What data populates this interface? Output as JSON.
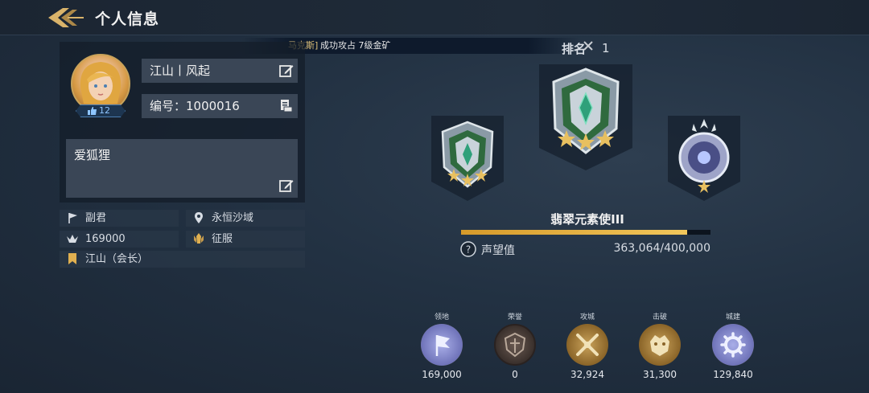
{
  "header": {
    "title": "个人信息"
  },
  "ticker": {
    "name": "马克斯]",
    "message": "成功攻占 7级金矿"
  },
  "profile": {
    "likes": "12",
    "nickname": "江山丨风起",
    "id_text": "编号：1000016",
    "signature": "爱狐狸"
  },
  "info": {
    "role": "副君",
    "region": "永恒沙域",
    "power": "169000",
    "mode": "征服",
    "guild": "江山（会长）"
  },
  "rank": {
    "label": "排名",
    "value": "1",
    "title": "翡翠元素使III",
    "reputation_label": "声望值",
    "reputation_text": "363,064/400,000",
    "progress_fraction": 0.9077
  },
  "stats": [
    {
      "label": "领地",
      "value": "169,000",
      "color": "#8c8fd6"
    },
    {
      "label": "荣誉",
      "value": "0",
      "color": "#5a4a44"
    },
    {
      "label": "攻城",
      "value": "32,924",
      "color": "#b58a3a"
    },
    {
      "label": "击破",
      "value": "31,300",
      "color": "#b58a3a"
    },
    {
      "label": "城建",
      "value": "129,840",
      "color": "#8c8fd6"
    }
  ],
  "colors": {
    "accent_gold": "#e0b050",
    "panel": "#3a4656"
  }
}
